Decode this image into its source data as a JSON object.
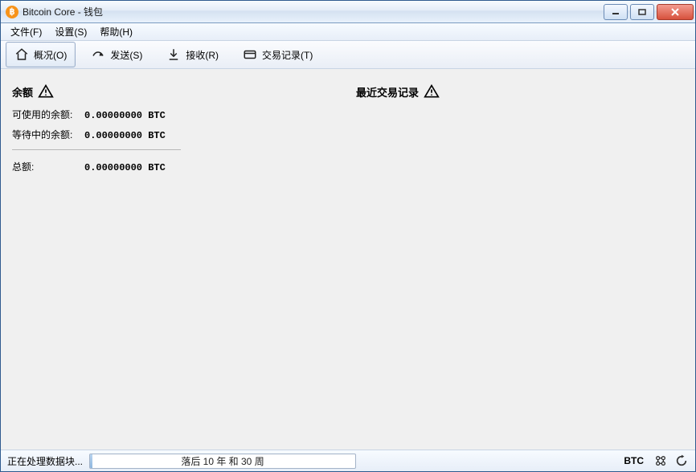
{
  "window": {
    "title": "Bitcoin Core - 钱包"
  },
  "menu": {
    "file": "文件(F)",
    "settings": "设置(S)",
    "help": "帮助(H)"
  },
  "toolbar": {
    "overview": "概况(O)",
    "send": "发送(S)",
    "receive": "接收(R)",
    "transactions": "交易记录(T)"
  },
  "overview": {
    "balances_title": "余额",
    "available_label": "可使用的余额:",
    "available_value": "0.00000000 BTC",
    "pending_label": "等待中的余额:",
    "pending_value": "0.00000000 BTC",
    "total_label": "总额:",
    "total_value": "0.00000000 BTC",
    "recent_title": "最近交易记录"
  },
  "status": {
    "processing": "正在处理数据块...",
    "progress_text": "落后 10 年 和 30 周",
    "unit": "BTC"
  }
}
